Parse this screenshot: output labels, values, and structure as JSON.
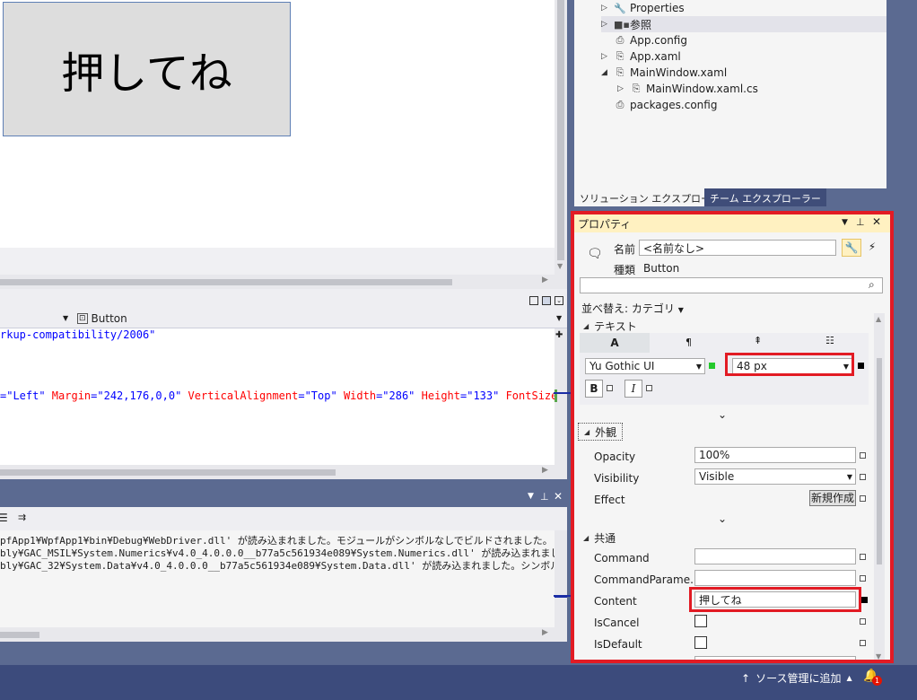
{
  "design": {
    "button_text": "押してね"
  },
  "xaml": {
    "element_selector": "Button",
    "lines": [
      {
        "parts": [
          {
            "t": "rkup-compatibility/2006\"",
            "c": "val"
          }
        ]
      },
      {
        "parts": [
          {
            "t": "=\"Left\" ",
            "c": "val"
          },
          {
            "t": "Margin",
            "c": "attr"
          },
          {
            "t": "=\"242,176,0,0\" ",
            "c": "val"
          },
          {
            "t": "VerticalAlignment",
            "c": "attr"
          },
          {
            "t": "=\"Top\" ",
            "c": "val"
          },
          {
            "t": "Width",
            "c": "attr"
          },
          {
            "t": "=\"286\" ",
            "c": "val"
          },
          {
            "t": "Height",
            "c": "attr"
          },
          {
            "t": "=\"133\" ",
            "c": "val"
          },
          {
            "t": "FontSize",
            "c": "attr"
          },
          {
            "t": "=\"",
            "c": "val"
          }
        ]
      }
    ]
  },
  "output": {
    "lines": [
      "pfApp1¥WpfApp1¥bin¥Debug¥WebDriver.dll' が読み込まれました。モジュールがシンボルなしでビルドされました。",
      "bly¥GAC_MSIL¥System.Numerics¥v4.0_4.0.0.0__b77a5c561934e089¥System.Numerics.dll' が読み込まれました。シ",
      "bly¥GAC_32¥System.Data¥v4.0_4.0.0.0__b77a5c561934e089¥System.Data.dll' が読み込まれました。シンボルの読"
    ]
  },
  "solution_explorer": {
    "items": [
      {
        "label": "Properties",
        "icon": "wrench-icon",
        "indent": 0,
        "arrow": "▷"
      },
      {
        "label": "参照",
        "icon": "references-icon",
        "indent": 0,
        "arrow": "▷"
      },
      {
        "label": "App.config",
        "icon": "config-file-icon",
        "indent": 0,
        "arrow": ""
      },
      {
        "label": "App.xaml",
        "icon": "xaml-file-icon",
        "indent": 0,
        "arrow": "▷"
      },
      {
        "label": "MainWindow.xaml",
        "icon": "xaml-file-icon",
        "indent": 0,
        "arrow": "◢"
      },
      {
        "label": "MainWindow.xaml.cs",
        "icon": "cs-file-icon",
        "indent": 1,
        "arrow": "▷"
      },
      {
        "label": "packages.config",
        "icon": "config-file-icon",
        "indent": 0,
        "arrow": ""
      }
    ],
    "tabs": [
      "ソリューション エクスプローラー",
      "チーム エクスプローラー"
    ]
  },
  "properties": {
    "title": "プロパティ",
    "name_label": "名前",
    "name_value": "<名前なし>",
    "type_label": "種類",
    "type_value": "Button",
    "sort_label": "並べ替え: カテゴリ",
    "sections": {
      "text": "テキスト",
      "appearance": "外観",
      "common": "共通"
    },
    "text_tabs": [
      "A",
      "¶",
      "",
      ""
    ],
    "font_family": "Yu Gothic UI",
    "font_size": "48 px",
    "bold_label": "B",
    "italic_label": "I",
    "appearance_rows": [
      {
        "label": "Opacity",
        "value": "100%"
      },
      {
        "label": "Visibility",
        "value": "Visible"
      },
      {
        "label": "Effect",
        "value": "新規作成"
      }
    ],
    "common_rows": [
      {
        "label": "Command",
        "value": ""
      },
      {
        "label": "CommandParame...",
        "value": ""
      },
      {
        "label": "Content",
        "value": "押してね"
      },
      {
        "label": "IsCancel",
        "value": ""
      },
      {
        "label": "IsDefault",
        "value": ""
      }
    ]
  },
  "statusbar": {
    "source_control": "ソース管理に追加",
    "notification_count": "1"
  }
}
